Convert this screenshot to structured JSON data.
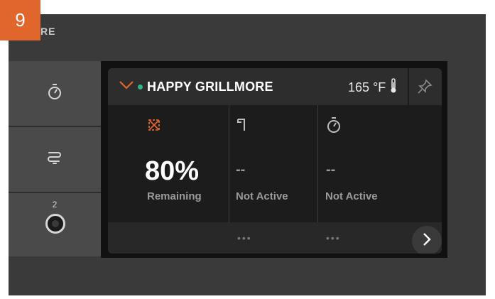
{
  "step": {
    "number": "9"
  },
  "app": {
    "brand_fragment": "RE"
  },
  "sidebar": {
    "items": [
      {
        "icon": "timer-icon"
      },
      {
        "icon": "smoke-icon"
      },
      {
        "icon": "probe-icon",
        "count": "2"
      }
    ]
  },
  "grill": {
    "name": "HAPPY GRILLMORE",
    "status_color": "#2bb68c",
    "temperature": "165",
    "unit": "°F",
    "columns": [
      {
        "icon": "pellet-hopper-icon",
        "value": "80%",
        "label": "Remaining"
      },
      {
        "icon": "probe-hook-icon",
        "value": "--",
        "label": "Not Active"
      },
      {
        "icon": "timer-icon",
        "value": "--",
        "label": "Not Active"
      }
    ],
    "footer_more": [
      "•••",
      "•••"
    ]
  },
  "colors": {
    "accent": "#e0662b",
    "status": "#2bb68c"
  }
}
